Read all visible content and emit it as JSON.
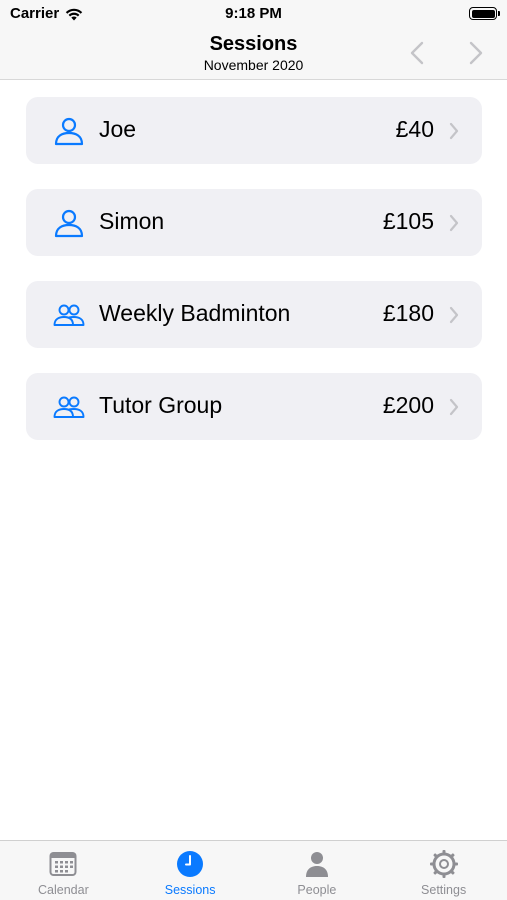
{
  "status_bar": {
    "carrier": "Carrier",
    "time": "9:18 PM"
  },
  "nav": {
    "title": "Sessions",
    "subtitle": "November 2020",
    "prev_icon": "chevron-left-icon",
    "next_icon": "chevron-right-icon"
  },
  "sessions": [
    {
      "name": "Joe",
      "amount": "£40",
      "icon": "person-icon"
    },
    {
      "name": "Simon",
      "amount": "£105",
      "icon": "person-icon"
    },
    {
      "name": "Weekly Badminton",
      "amount": "£180",
      "icon": "group-icon"
    },
    {
      "name": "Tutor Group",
      "amount": "£200",
      "icon": "group-icon"
    }
  ],
  "tabs": [
    {
      "label": "Calendar",
      "icon": "calendar-icon",
      "active": false
    },
    {
      "label": "Sessions",
      "icon": "clock-icon",
      "active": true
    },
    {
      "label": "People",
      "icon": "person-icon",
      "active": false
    },
    {
      "label": "Settings",
      "icon": "gear-icon",
      "active": false
    }
  ],
  "colors": {
    "accent": "#0a7aff",
    "row_background": "#f0f0f4",
    "inactive_tab": "#8e8e93"
  }
}
